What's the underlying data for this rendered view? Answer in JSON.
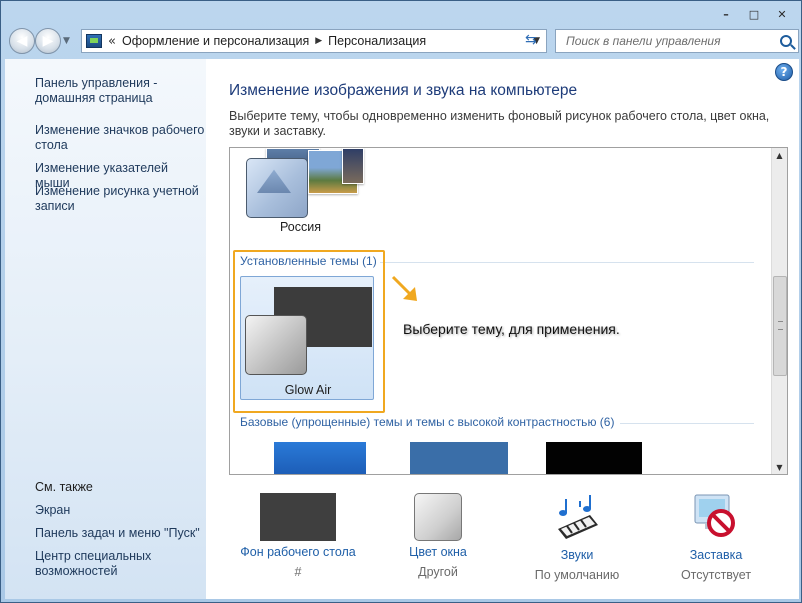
{
  "window": {
    "caption_buttons": [
      "minimize",
      "maximize",
      "close"
    ]
  },
  "nav": {
    "breadcrumbs": [
      "Оформление и персонализация",
      "Персонализация"
    ],
    "search_placeholder": "Поиск в панели управления"
  },
  "sidebar": {
    "links": [
      "Панель управления - домашняя страница",
      "Изменение значков рабочего стола",
      "Изменение указателей мыши",
      "Изменение рисунка учетной записи"
    ],
    "see_also_title": "См. также",
    "see_also": [
      "Экран",
      "Панель задач и меню \"Пуск\"",
      "Центр специальных возможностей"
    ]
  },
  "main": {
    "title": "Изменение изображения и звука на компьютере",
    "description": "Выберите тему, чтобы одновременно изменить фоновый рисунок рабочего стола, цвет окна, звуки и заставку."
  },
  "themes": {
    "my_theme_name": "Россия",
    "installed_header": "Установленные темы (1)",
    "installed": [
      {
        "name": "Glow Air"
      }
    ],
    "basic_header": "Базовые (упрощенные) темы и темы с высокой контрастностью (6)"
  },
  "callout": {
    "text": "Выберите тему, для применения."
  },
  "bottom": {
    "items": [
      {
        "label": "Фон рабочего стола",
        "value": "#"
      },
      {
        "label": "Цвет окна",
        "value": "Другой"
      },
      {
        "label": "Звуки",
        "value": "По умолчанию"
      },
      {
        "label": "Заставка",
        "value": "Отсутствует"
      }
    ]
  },
  "colors": {
    "highlight": "#f0a820",
    "link": "#1f5fa8",
    "title": "#1e3c7a"
  }
}
